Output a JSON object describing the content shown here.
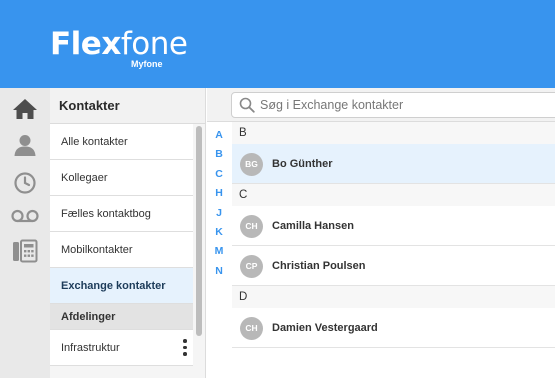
{
  "brand": {
    "name_bold": "Flex",
    "name_light": "fone",
    "sub": "Myfone"
  },
  "rail": [
    {
      "icon": "home-icon"
    },
    {
      "icon": "person-icon"
    },
    {
      "icon": "clock-icon"
    },
    {
      "icon": "voicemail-icon"
    },
    {
      "icon": "fax-icon"
    }
  ],
  "submenu": {
    "title": "Kontakter",
    "items": [
      {
        "label": "Alle kontakter"
      },
      {
        "label": "Kollegaer"
      },
      {
        "label": "Fælles kontaktbog"
      },
      {
        "label": "Mobilkontakter"
      },
      {
        "label": "Exchange kontakter",
        "active": true
      }
    ],
    "section": "Afdelinger",
    "departments": [
      {
        "label": "Infrastruktur"
      }
    ]
  },
  "search": {
    "placeholder": "Søg i Exchange kontakter"
  },
  "alphabet": [
    "A",
    "B",
    "C",
    "H",
    "J",
    "K",
    "M",
    "N"
  ],
  "groups": [
    {
      "letter": "B",
      "contacts": [
        {
          "initials": "BG",
          "name": "Bo Günther",
          "highlight": true
        }
      ]
    },
    {
      "letter": "C",
      "contacts": [
        {
          "initials": "CH",
          "name": "Camilla Hansen"
        },
        {
          "initials": "CP",
          "name": "Christian Poulsen"
        }
      ]
    },
    {
      "letter": "D",
      "contacts": [
        {
          "initials": "CH",
          "name": "Damien Vestergaard"
        }
      ]
    }
  ],
  "colors": {
    "brand_blue": "#3894ee",
    "active_bg": "#e6f2fd",
    "avatar_grey": "#b8b8b8"
  }
}
